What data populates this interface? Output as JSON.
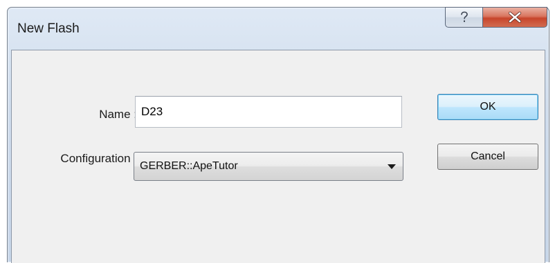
{
  "window": {
    "title": "New Flash"
  },
  "caption_buttons": {
    "help_icon": "help-question-icon",
    "close_icon": "close-x-icon",
    "close_color": "#c7452b"
  },
  "form": {
    "name_label": "Name :",
    "name_value": "D23",
    "configuration_label": "Configuration :",
    "configuration_value": "GERBER::ApeTutor"
  },
  "buttons": {
    "ok_label": "OK",
    "cancel_label": "Cancel"
  }
}
